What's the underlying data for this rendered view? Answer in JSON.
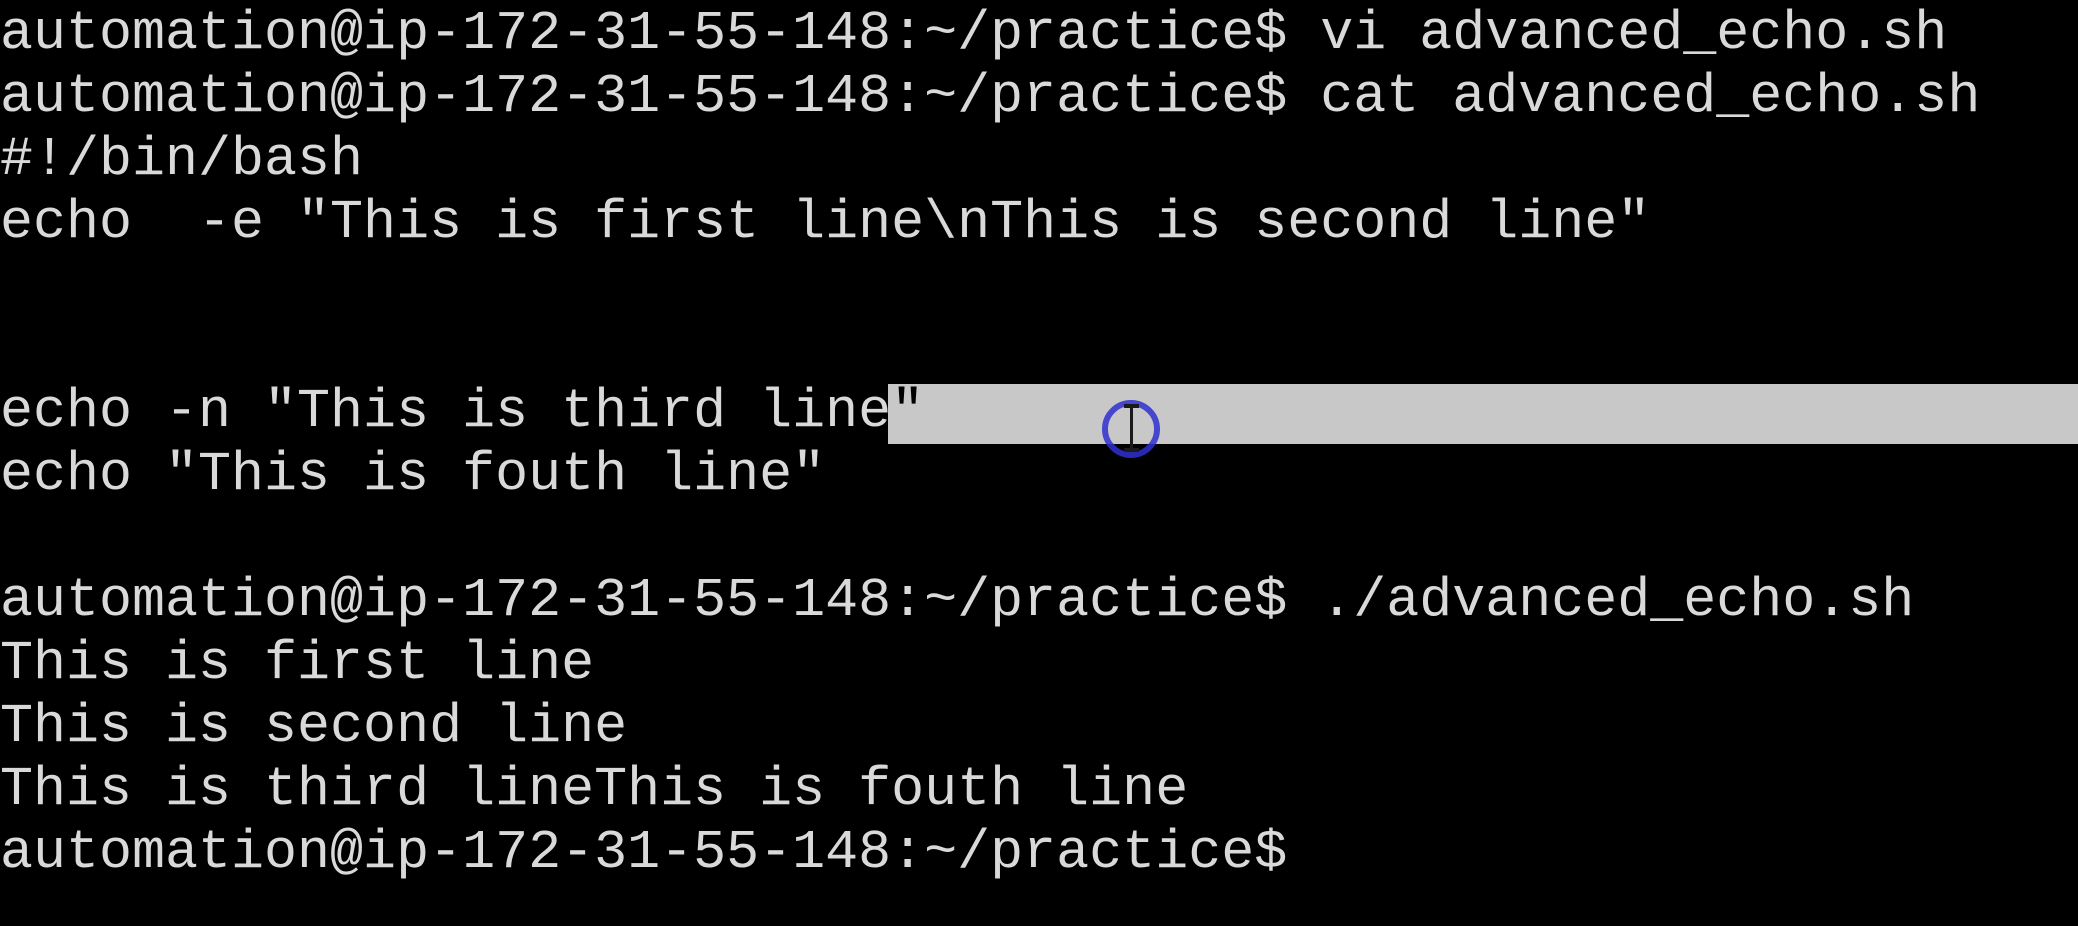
{
  "terminal": {
    "lines": [
      "automation@ip-172-31-55-148:~/practice$ vi advanced_echo.sh",
      "automation@ip-172-31-55-148:~/practice$ cat advanced_echo.sh",
      "#!/bin/bash",
      "echo  -e \"This is first line\\nThis is second line\"",
      "",
      "",
      "echo -n \"This is third line",
      "echo \"This is fouth line\"",
      "",
      "automation@ip-172-31-55-148:~/practice$ ./advanced_echo.sh",
      "This is first line",
      "This is second line",
      "This is third lineThis is fouth line",
      "automation@ip-172-31-55-148:~/practice$"
    ],
    "selected_text": "\"",
    "colors": {
      "background": "#000000",
      "foreground": "#d9d9d9",
      "selection": "#c8c8c8",
      "cursor_ring": "#2f2fd0"
    },
    "icons": {
      "mouse_cursor": "text-ibeam-cursor-icon",
      "click_highlight": "click-ring-icon"
    }
  }
}
